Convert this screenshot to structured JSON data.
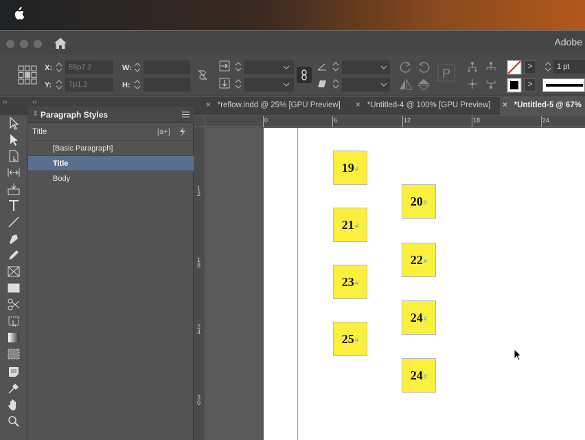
{
  "app": {
    "title": "Adobe"
  },
  "control_bar": {
    "x_label": "X:",
    "x_value": "55p7.2",
    "y_label": "Y:",
    "y_value": "7p1.2",
    "w_label": "W:",
    "h_label": "H:",
    "stroke_weight": "1 pt"
  },
  "tabs": [
    {
      "label": "*reflow.indd @ 25% [GPU Preview]",
      "active": false
    },
    {
      "label": "*Untitled-4 @ 100% [GPU Preview]",
      "active": false
    },
    {
      "label": "*Untitled-5 @ 67%",
      "active": true
    }
  ],
  "tab_close_glyph": "×",
  "paragraph_styles": {
    "panel_title": "Paragraph Styles",
    "current_style": "Title",
    "new_style_glyph": "[a+]",
    "items": [
      {
        "label": "[Basic Paragraph]",
        "selected": false
      },
      {
        "label": "Title",
        "selected": true
      },
      {
        "label": "Body",
        "selected": false
      }
    ]
  },
  "ruler": {
    "horizontal": [
      "0",
      "6",
      "12",
      "18",
      "24"
    ],
    "vertical": [
      "12",
      "18",
      "24",
      "30"
    ]
  },
  "frames": [
    {
      "number": "19",
      "mark": "#"
    },
    {
      "number": "20",
      "mark": "#"
    },
    {
      "number": "21",
      "mark": "#"
    },
    {
      "number": "22",
      "mark": "#"
    },
    {
      "number": "23",
      "mark": "#"
    },
    {
      "number": "24",
      "mark": "#"
    },
    {
      "number": "25",
      "mark": "#"
    },
    {
      "number": "24",
      "mark": "#"
    }
  ],
  "colors": {
    "frame_fill": "#fbf03e",
    "selection": "#5b6e8e",
    "margin_guide": "#b48cdf"
  }
}
